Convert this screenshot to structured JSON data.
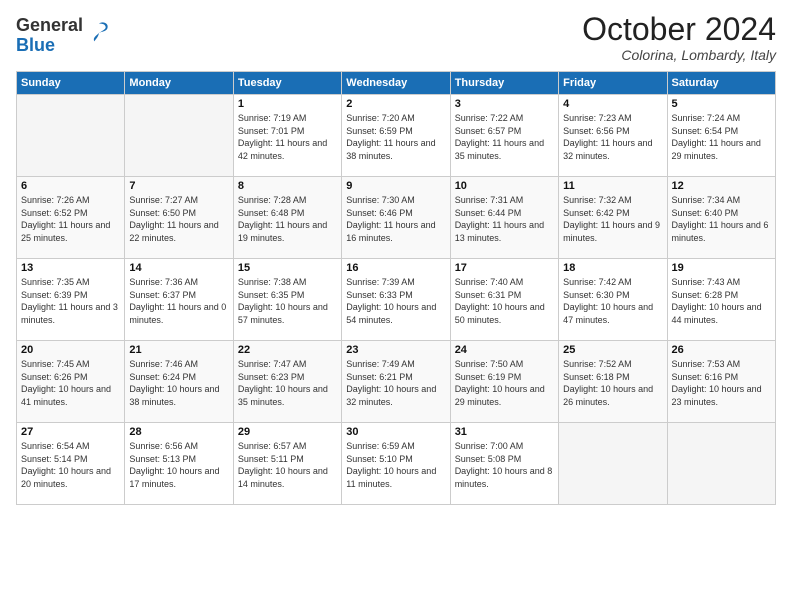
{
  "header": {
    "logo_general": "General",
    "logo_blue": "Blue",
    "month_title": "October 2024",
    "location": "Colorina, Lombardy, Italy"
  },
  "weekdays": [
    "Sunday",
    "Monday",
    "Tuesday",
    "Wednesday",
    "Thursday",
    "Friday",
    "Saturday"
  ],
  "weeks": [
    [
      {
        "day": "",
        "empty": true
      },
      {
        "day": "",
        "empty": true
      },
      {
        "day": "1",
        "sunrise": "7:19 AM",
        "sunset": "7:01 PM",
        "daylight": "11 hours and 42 minutes."
      },
      {
        "day": "2",
        "sunrise": "7:20 AM",
        "sunset": "6:59 PM",
        "daylight": "11 hours and 38 minutes."
      },
      {
        "day": "3",
        "sunrise": "7:22 AM",
        "sunset": "6:57 PM",
        "daylight": "11 hours and 35 minutes."
      },
      {
        "day": "4",
        "sunrise": "7:23 AM",
        "sunset": "6:56 PM",
        "daylight": "11 hours and 32 minutes."
      },
      {
        "day": "5",
        "sunrise": "7:24 AM",
        "sunset": "6:54 PM",
        "daylight": "11 hours and 29 minutes."
      }
    ],
    [
      {
        "day": "6",
        "sunrise": "7:26 AM",
        "sunset": "6:52 PM",
        "daylight": "11 hours and 25 minutes."
      },
      {
        "day": "7",
        "sunrise": "7:27 AM",
        "sunset": "6:50 PM",
        "daylight": "11 hours and 22 minutes."
      },
      {
        "day": "8",
        "sunrise": "7:28 AM",
        "sunset": "6:48 PM",
        "daylight": "11 hours and 19 minutes."
      },
      {
        "day": "9",
        "sunrise": "7:30 AM",
        "sunset": "6:46 PM",
        "daylight": "11 hours and 16 minutes."
      },
      {
        "day": "10",
        "sunrise": "7:31 AM",
        "sunset": "6:44 PM",
        "daylight": "11 hours and 13 minutes."
      },
      {
        "day": "11",
        "sunrise": "7:32 AM",
        "sunset": "6:42 PM",
        "daylight": "11 hours and 9 minutes."
      },
      {
        "day": "12",
        "sunrise": "7:34 AM",
        "sunset": "6:40 PM",
        "daylight": "11 hours and 6 minutes."
      }
    ],
    [
      {
        "day": "13",
        "sunrise": "7:35 AM",
        "sunset": "6:39 PM",
        "daylight": "11 hours and 3 minutes."
      },
      {
        "day": "14",
        "sunrise": "7:36 AM",
        "sunset": "6:37 PM",
        "daylight": "11 hours and 0 minutes."
      },
      {
        "day": "15",
        "sunrise": "7:38 AM",
        "sunset": "6:35 PM",
        "daylight": "10 hours and 57 minutes."
      },
      {
        "day": "16",
        "sunrise": "7:39 AM",
        "sunset": "6:33 PM",
        "daylight": "10 hours and 54 minutes."
      },
      {
        "day": "17",
        "sunrise": "7:40 AM",
        "sunset": "6:31 PM",
        "daylight": "10 hours and 50 minutes."
      },
      {
        "day": "18",
        "sunrise": "7:42 AM",
        "sunset": "6:30 PM",
        "daylight": "10 hours and 47 minutes."
      },
      {
        "day": "19",
        "sunrise": "7:43 AM",
        "sunset": "6:28 PM",
        "daylight": "10 hours and 44 minutes."
      }
    ],
    [
      {
        "day": "20",
        "sunrise": "7:45 AM",
        "sunset": "6:26 PM",
        "daylight": "10 hours and 41 minutes."
      },
      {
        "day": "21",
        "sunrise": "7:46 AM",
        "sunset": "6:24 PM",
        "daylight": "10 hours and 38 minutes."
      },
      {
        "day": "22",
        "sunrise": "7:47 AM",
        "sunset": "6:23 PM",
        "daylight": "10 hours and 35 minutes."
      },
      {
        "day": "23",
        "sunrise": "7:49 AM",
        "sunset": "6:21 PM",
        "daylight": "10 hours and 32 minutes."
      },
      {
        "day": "24",
        "sunrise": "7:50 AM",
        "sunset": "6:19 PM",
        "daylight": "10 hours and 29 minutes."
      },
      {
        "day": "25",
        "sunrise": "7:52 AM",
        "sunset": "6:18 PM",
        "daylight": "10 hours and 26 minutes."
      },
      {
        "day": "26",
        "sunrise": "7:53 AM",
        "sunset": "6:16 PM",
        "daylight": "10 hours and 23 minutes."
      }
    ],
    [
      {
        "day": "27",
        "sunrise": "6:54 AM",
        "sunset": "5:14 PM",
        "daylight": "10 hours and 20 minutes."
      },
      {
        "day": "28",
        "sunrise": "6:56 AM",
        "sunset": "5:13 PM",
        "daylight": "10 hours and 17 minutes."
      },
      {
        "day": "29",
        "sunrise": "6:57 AM",
        "sunset": "5:11 PM",
        "daylight": "10 hours and 14 minutes."
      },
      {
        "day": "30",
        "sunrise": "6:59 AM",
        "sunset": "5:10 PM",
        "daylight": "10 hours and 11 minutes."
      },
      {
        "day": "31",
        "sunrise": "7:00 AM",
        "sunset": "5:08 PM",
        "daylight": "10 hours and 8 minutes."
      },
      {
        "day": "",
        "empty": true
      },
      {
        "day": "",
        "empty": true
      }
    ]
  ],
  "labels": {
    "sunrise": "Sunrise: ",
    "sunset": "Sunset: ",
    "daylight": "Daylight: "
  }
}
